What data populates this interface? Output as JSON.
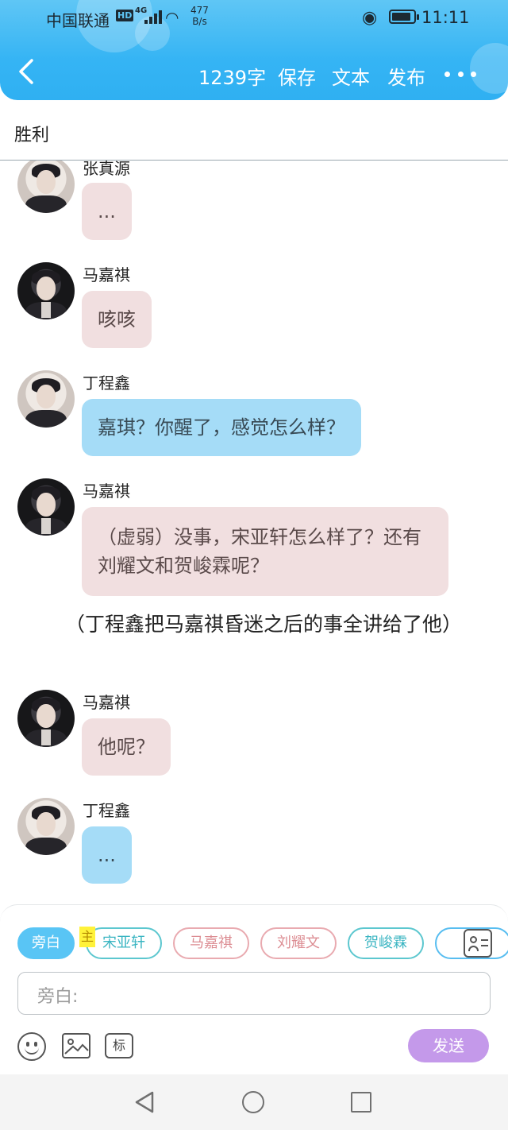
{
  "status_bar": {
    "carrier": "中国联通",
    "hd_badge": "HD",
    "network": "4G",
    "speed_value": "477",
    "speed_unit": "B/s",
    "time": "11:11"
  },
  "header": {
    "word_count": "1239字",
    "save_label": "保存",
    "text_label": "文本",
    "publish_label": "发布"
  },
  "title": "胜利",
  "messages": [
    {
      "speaker": "张真源",
      "text": "...",
      "style": "pink"
    },
    {
      "speaker": "马嘉祺",
      "text": "咳咳",
      "style": "pink"
    },
    {
      "speaker": "丁程鑫",
      "text": "嘉琪？你醒了，感觉怎么样？",
      "style": "blue"
    },
    {
      "speaker": "马嘉祺",
      "text": "（虚弱）没事，宋亚轩怎么样了？还有刘耀文和贺峻霖呢？",
      "style": "pink"
    },
    {
      "narration": "（丁程鑫把马嘉祺昏迷之后的事全讲给了他）"
    },
    {
      "speaker": "马嘉祺",
      "text": "他呢？",
      "style": "pink"
    },
    {
      "speaker": "丁程鑫",
      "text": "...",
      "style": "blue"
    }
  ],
  "roles": {
    "main_badge": "主",
    "items": [
      {
        "label": "旁白",
        "state": "active"
      },
      {
        "label": "宋亚轩",
        "state": "teal"
      },
      {
        "label": "马嘉祺",
        "state": "pink"
      },
      {
        "label": "刘耀文",
        "state": "pink"
      },
      {
        "label": "贺峻霖",
        "state": "teal"
      }
    ]
  },
  "input": {
    "placeholder": "旁白:"
  },
  "tools": {
    "tag_label": "标"
  },
  "send_label": "发送",
  "colors": {
    "header_blue": "#35b4f4",
    "bubble_pink": "#f1dfe0",
    "bubble_blue": "#a5dcf7",
    "send_purple": "#c499ea"
  }
}
